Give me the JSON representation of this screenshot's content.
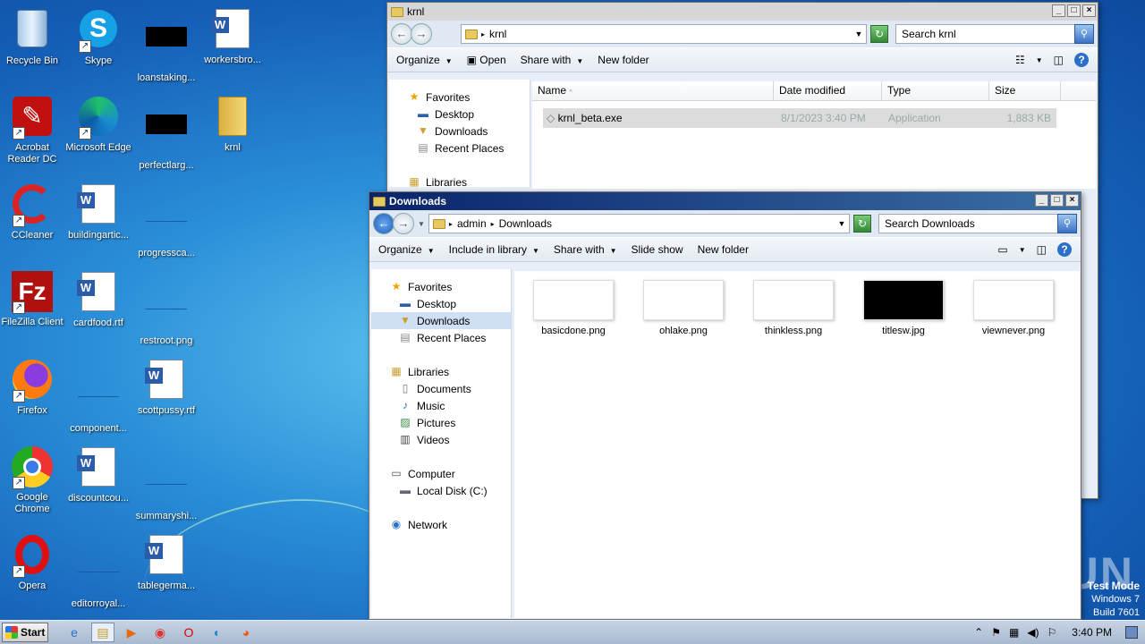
{
  "desktop": {
    "icons": [
      {
        "label": "Recycle Bin",
        "icon": "recycle-bin-icon"
      },
      {
        "label": "Skype",
        "icon": "skype-icon"
      },
      {
        "label": "loanstaking...",
        "icon": "black-thumbnail-icon"
      },
      {
        "label": "workersbro...",
        "icon": "word-document-icon"
      },
      {
        "label": "Acrobat Reader DC",
        "icon": "acrobat-icon"
      },
      {
        "label": "Microsoft Edge",
        "icon": "edge-icon"
      },
      {
        "label": "perfectlarg...",
        "icon": "black-thumbnail-icon"
      },
      {
        "label": "krnl",
        "icon": "folder-icon"
      },
      {
        "label": "CCleaner",
        "icon": "ccleaner-icon"
      },
      {
        "label": "buildingartic...",
        "icon": "word-document-icon"
      },
      {
        "label": "progressca...",
        "icon": "image-file-icon"
      },
      {
        "label": "FileZilla Client",
        "icon": "filezilla-icon"
      },
      {
        "label": "cardfood.rtf",
        "icon": "word-document-icon"
      },
      {
        "label": "restroot.png",
        "icon": "image-file-icon"
      },
      {
        "label": "Firefox",
        "icon": "firefox-icon"
      },
      {
        "label": "component...",
        "icon": "image-file-icon"
      },
      {
        "label": "scottpussy.rtf",
        "icon": "word-document-icon"
      },
      {
        "label": "Google Chrome",
        "icon": "chrome-icon"
      },
      {
        "label": "discountcou...",
        "icon": "word-document-icon"
      },
      {
        "label": "summaryshi...",
        "icon": "image-file-icon"
      },
      {
        "label": "Opera",
        "icon": "opera-icon"
      },
      {
        "label": "editorroyal...",
        "icon": "image-file-icon"
      },
      {
        "label": "tablegerma...",
        "icon": "word-document-icon"
      }
    ]
  },
  "krnl_window": {
    "title": "krnl",
    "address": "krnl",
    "search_placeholder": "Search krnl",
    "commands": {
      "organize": "Organize",
      "open": "Open",
      "share_with": "Share with",
      "new_folder": "New folder"
    },
    "nav": {
      "favorites": "Favorites",
      "desktop": "Desktop",
      "downloads": "Downloads",
      "recent_places": "Recent Places",
      "libraries": "Libraries"
    },
    "columns": {
      "name": "Name",
      "date_modified": "Date modified",
      "type": "Type",
      "size": "Size"
    },
    "file": {
      "name": "krnl_beta.exe",
      "date": "8/1/2023 3:40 PM",
      "type": "Application",
      "size": "1,883 KB"
    }
  },
  "downloads_window": {
    "title": "Downloads",
    "breadcrumb": {
      "root": "admin",
      "current": "Downloads"
    },
    "search_placeholder": "Search Downloads",
    "commands": {
      "organize": "Organize",
      "include_in_library": "Include in library",
      "share_with": "Share with",
      "slide_show": "Slide show",
      "new_folder": "New folder"
    },
    "nav": {
      "favorites": "Favorites",
      "desktop": "Desktop",
      "downloads": "Downloads",
      "recent_places": "Recent Places",
      "libraries": "Libraries",
      "documents": "Documents",
      "music": "Music",
      "pictures": "Pictures",
      "videos": "Videos",
      "computer": "Computer",
      "local_disk": "Local Disk (C:)",
      "network": "Network"
    },
    "files": [
      {
        "name": "basicdone.png",
        "dark": false
      },
      {
        "name": "ohlake.png",
        "dark": false
      },
      {
        "name": "thinkless.png",
        "dark": false
      },
      {
        "name": "titlesw.jpg",
        "dark": true
      },
      {
        "name": "viewnever.png",
        "dark": false
      }
    ]
  },
  "taskbar": {
    "start_label": "Start",
    "clock": "3:40 PM",
    "apps": [
      "ie-icon",
      "explorer-icon",
      "media-player-icon",
      "chrome-icon",
      "opera-icon",
      "edge-icon",
      "firefox-icon"
    ]
  },
  "watermark": "ANY RUN",
  "test_mode": {
    "line1": "Test Mode",
    "line2": "Windows 7",
    "line3": "Build 7601"
  }
}
